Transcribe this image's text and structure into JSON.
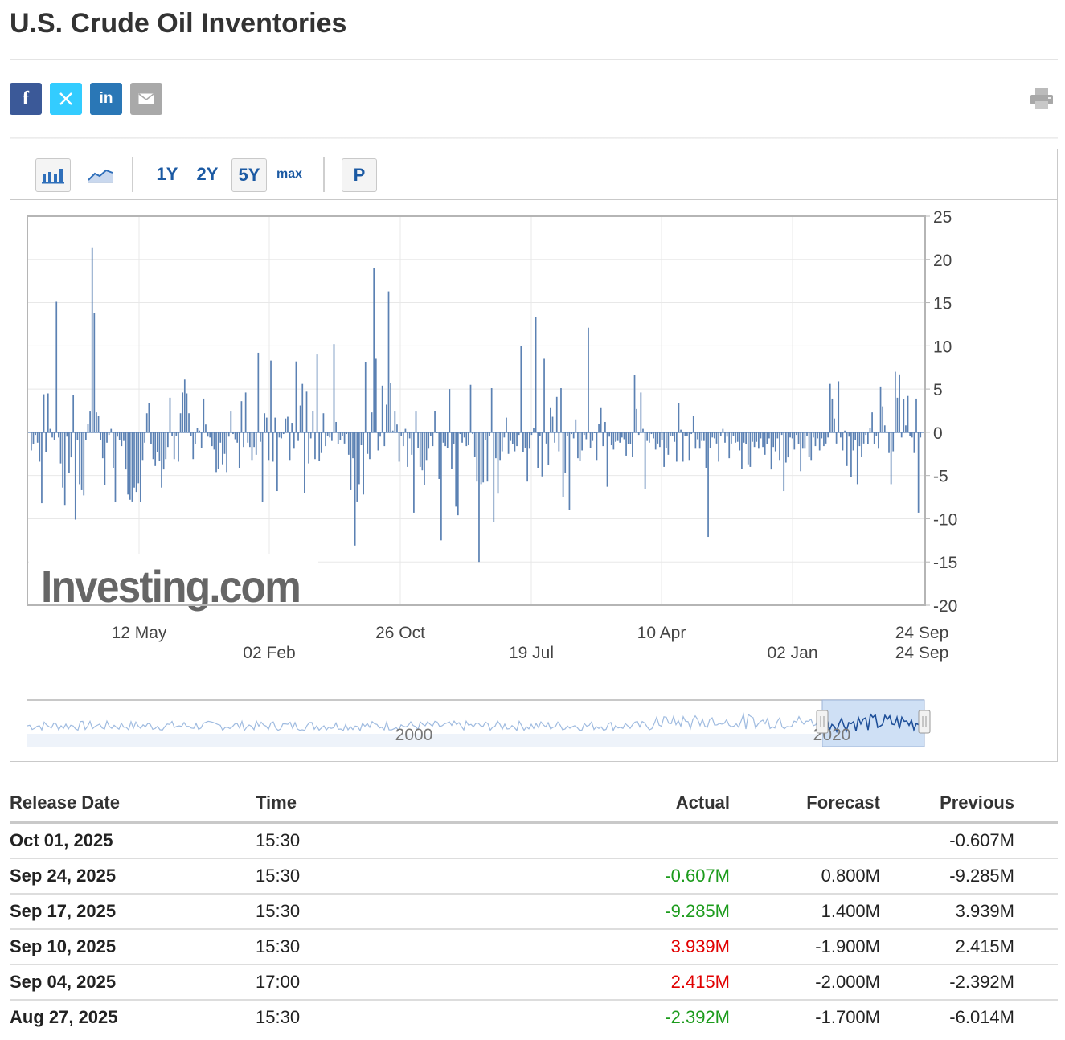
{
  "page": {
    "title": "U.S. Crude Oil Inventories"
  },
  "share": {
    "facebook": "f",
    "linkedin": "in",
    "colors": {
      "facebook": "#3b5998",
      "twitter": "#33ccff",
      "linkedin": "#2a77b6",
      "email": "#a9a9a9"
    }
  },
  "toolbar": {
    "ranges": [
      "1Y",
      "2Y",
      "5Y",
      "max"
    ],
    "selected_range": "5Y",
    "p_label": "P"
  },
  "chart_data": {
    "type": "bar",
    "title": "",
    "ylim": [
      -20,
      25
    ],
    "yticks": [
      "25",
      "20",
      "15",
      "10",
      "5",
      "0",
      "-5",
      "-10",
      "-15",
      "-20"
    ],
    "xticks_upper": [
      "12 May",
      "26 Oct",
      "10 Apr",
      "24 Sep"
    ],
    "xticks_lower": [
      "02 Feb",
      "19 Jul",
      "02 Jan",
      "24 Sep"
    ],
    "navigator_labels": [
      "2000",
      "2020"
    ],
    "watermark": "Investing.com",
    "bar_color": "#5b81b3",
    "values": [
      -2.1,
      -1.4,
      -0.3,
      -1.2,
      -3.4,
      -8.2,
      4.4,
      -2.3,
      4.5,
      0.4,
      -0.6,
      -0.9,
      15.1,
      -0.6,
      -3.6,
      -6.4,
      -8.4,
      -0.5,
      -4.7,
      -2.9,
      4.3,
      -10.1,
      -0.9,
      -6.0,
      -6.7,
      -7.3,
      -0.9,
      1.0,
      2.4,
      21.4,
      13.8,
      2.3,
      1.9,
      -0.9,
      -3.0,
      -6.1,
      -1.2,
      -0.3,
      0.4,
      -4.1,
      -8.1,
      -0.5,
      -0.9,
      -1.6,
      -1.0,
      -4.3,
      -7.2,
      -7.8,
      -8.0,
      -6.4,
      -6.9,
      -5.9,
      -8.1,
      -3.2,
      -1.2,
      2.2,
      3.4,
      -1.4,
      -3.1,
      -3.9,
      -2.3,
      -3.3,
      -6.4,
      -4.3,
      -3.1,
      -1.7,
      4.0,
      -0.4,
      -3.1,
      -0.4,
      -3.4,
      2.2,
      4.6,
      6.1,
      4.5,
      2.2,
      -0.4,
      -3.1,
      -1.4,
      0.5,
      0.2,
      -1.8,
      3.9,
      0.9,
      -0.5,
      -0.6,
      -1.6,
      -2.0,
      -4.6,
      -4.2,
      -1.2,
      -3.7,
      -2.5,
      -4.6,
      -0.5,
      2.4,
      -0.2,
      -0.8,
      -1.2,
      -4.1,
      3.6,
      -1.7,
      4.6,
      -1.2,
      -1.7,
      -3.2,
      -1.7,
      -2.6,
      9.2,
      -1.1,
      -8.1,
      2.2,
      1.7,
      -3.2,
      8.3,
      -3.4,
      1.7,
      -6.8,
      -0.6,
      -0.7,
      -0.2,
      1.6,
      1.8,
      -3.2,
      1.1,
      -1.9,
      8.2,
      -1.0,
      3.1,
      5.6,
      -7.0,
      4.7,
      -3.6,
      -0.7,
      2.5,
      -3.1,
      9.0,
      -3.3,
      -2.4,
      2.2,
      -1.6,
      -0.4,
      -0.6,
      -1.0,
      10.2,
      1.2,
      -1.4,
      -0.9,
      -0.4,
      -1.3,
      -0.2,
      -2.6,
      -6.7,
      -3.0,
      -13.1,
      -8.0,
      -6.0,
      -1.5,
      -7.2,
      8.1,
      -2.5,
      -3.1,
      2.3,
      19.0,
      8.5,
      -2.1,
      -0.5,
      5.4,
      -1.6,
      3.2,
      16.3,
      5.7,
      0.2,
      2.4,
      0.9,
      -3.4,
      -0.4,
      -1.6,
      0.4,
      -4.0,
      -0.7,
      -2.6,
      -9.3,
      2.4,
      -1.8,
      -4.0,
      -4.4,
      -6.1,
      -3.2,
      -1.9,
      -0.4,
      -1.6,
      2.5,
      -0.1,
      -5.4,
      -12.5,
      -1.2,
      -1.6,
      -1.8,
      5.0,
      -4.2,
      -1.4,
      -8.6,
      -9.6,
      -0.2,
      -1.2,
      -0.6,
      -1.6,
      -1.5,
      5.5,
      -0.2,
      -2.8,
      -5.7,
      -15.0,
      -6.0,
      -5.8,
      -0.9,
      -5.7,
      -0.4,
      5.1,
      -10.4,
      -3.0,
      -7.1,
      -3.2,
      -2.2,
      -0.6,
      1.7,
      -2.5,
      -1.0,
      -1.4,
      -2.2,
      -1.6,
      -0.3,
      10.0,
      -2.3,
      -1.8,
      -5.7,
      -1.9,
      -0.3,
      0.5,
      13.3,
      -4.1,
      -0.4,
      -5.1,
      8.5,
      -1.3,
      -3.8,
      2.8,
      1.8,
      -1.2,
      4.1,
      -2.2,
      5.1,
      -7.5,
      -4.7,
      -0.4,
      -9.0,
      -0.2,
      -0.7,
      1.5,
      -3.0,
      -3.3,
      -2.1,
      -0.3,
      -0.8,
      12.1,
      -1.8,
      -1.0,
      -0.1,
      -3.2,
      1.0,
      2.8,
      -1.6,
      1.2,
      -6.3,
      -0.5,
      -1.5,
      -2.0,
      -1.1,
      -1.0,
      -1.2,
      -0.6,
      -0.8,
      -2.7,
      -1.4,
      -1.4,
      -2.8,
      6.6,
      2.7,
      -0.3,
      4.6,
      0.4,
      -6.6,
      -1.0,
      -1.2,
      -0.2,
      -0.7,
      -2.0,
      -1.3,
      -1.7,
      -0.9,
      -4.0,
      -1.8,
      -2.6,
      -0.4,
      -0.4,
      -1.1,
      -3.4,
      3.4,
      0.3,
      -3.4,
      -0.4,
      -0.4,
      -3.2,
      -0.2,
      1.9,
      -1.9,
      -0.8,
      -1.9,
      -1.0,
      -1.0,
      -4.1,
      -12.1,
      -1.8,
      -0.6,
      -0.7,
      -1.3,
      -3.4,
      -0.4,
      0.4,
      -1.2,
      -0.5,
      -3.0,
      -1.3,
      -0.4,
      -1.2,
      -1.1,
      -2.1,
      -4.2,
      -1.2,
      -1.4,
      -3.7,
      -4.0,
      -1.1,
      -1.7,
      -1.1,
      -1.9,
      -0.7,
      -1.7,
      -2.6,
      -1.4,
      -0.7,
      -4.3,
      -1.7,
      -2.2,
      -0.7,
      -3.2,
      -0.3,
      -6.8,
      -3.5,
      -2.9,
      -0.6,
      -0.7,
      -2.0,
      -0.3,
      -1.4,
      -4.5,
      -1.9,
      -1.9,
      -0.4,
      -2.8,
      -3.2,
      -0.6,
      -1.6,
      -0.7,
      -2.1,
      -0.7,
      -1.6,
      -1.3,
      -0.6,
      5.6,
      3.9,
      1.6,
      -1.3,
      5.9,
      -0.6,
      -2.1,
      0.2,
      -3.9,
      -0.5,
      -5.2,
      -2.1,
      -0.9,
      -6.0,
      -1.6,
      -2.8,
      -1.3,
      -0.3,
      -1.4,
      0.5,
      2.3,
      -1.4,
      -0.4,
      -1.9,
      5.3,
      3.0,
      0.8,
      0.1,
      -2.4,
      -6.0,
      -2.2,
      7.0,
      4.0,
      6.7,
      -0.6,
      3.8,
      0.8,
      4.2,
      -0.4,
      -0.6,
      -2.4,
      3.9,
      -9.3,
      -0.6
    ],
    "color_notes": {
      "navigator_line": "#9fbbe0",
      "navigator_selected_line": "#1e4f99",
      "navigator_fill": "#cfe0f5"
    }
  },
  "table": {
    "headers": [
      "Release Date",
      "Time",
      "Actual",
      "Forecast",
      "Previous"
    ],
    "rows": [
      {
        "date": "Oct 01, 2025",
        "time": "15:30",
        "actual": "",
        "actual_color": "",
        "forecast": "",
        "previous": "-0.607M"
      },
      {
        "date": "Sep 24, 2025",
        "time": "15:30",
        "actual": "-0.607M",
        "actual_color": "green",
        "forecast": "0.800M",
        "previous": "-9.285M"
      },
      {
        "date": "Sep 17, 2025",
        "time": "15:30",
        "actual": "-9.285M",
        "actual_color": "green",
        "forecast": "1.400M",
        "previous": "3.939M"
      },
      {
        "date": "Sep 10, 2025",
        "time": "15:30",
        "actual": "3.939M",
        "actual_color": "red",
        "forecast": "-1.900M",
        "previous": "2.415M"
      },
      {
        "date": "Sep 04, 2025",
        "time": "17:00",
        "actual": "2.415M",
        "actual_color": "red",
        "forecast": "-2.000M",
        "previous": "-2.392M"
      },
      {
        "date": "Aug 27, 2025",
        "time": "15:30",
        "actual": "-2.392M",
        "actual_color": "green",
        "forecast": "-1.700M",
        "previous": "-6.014M"
      }
    ]
  }
}
